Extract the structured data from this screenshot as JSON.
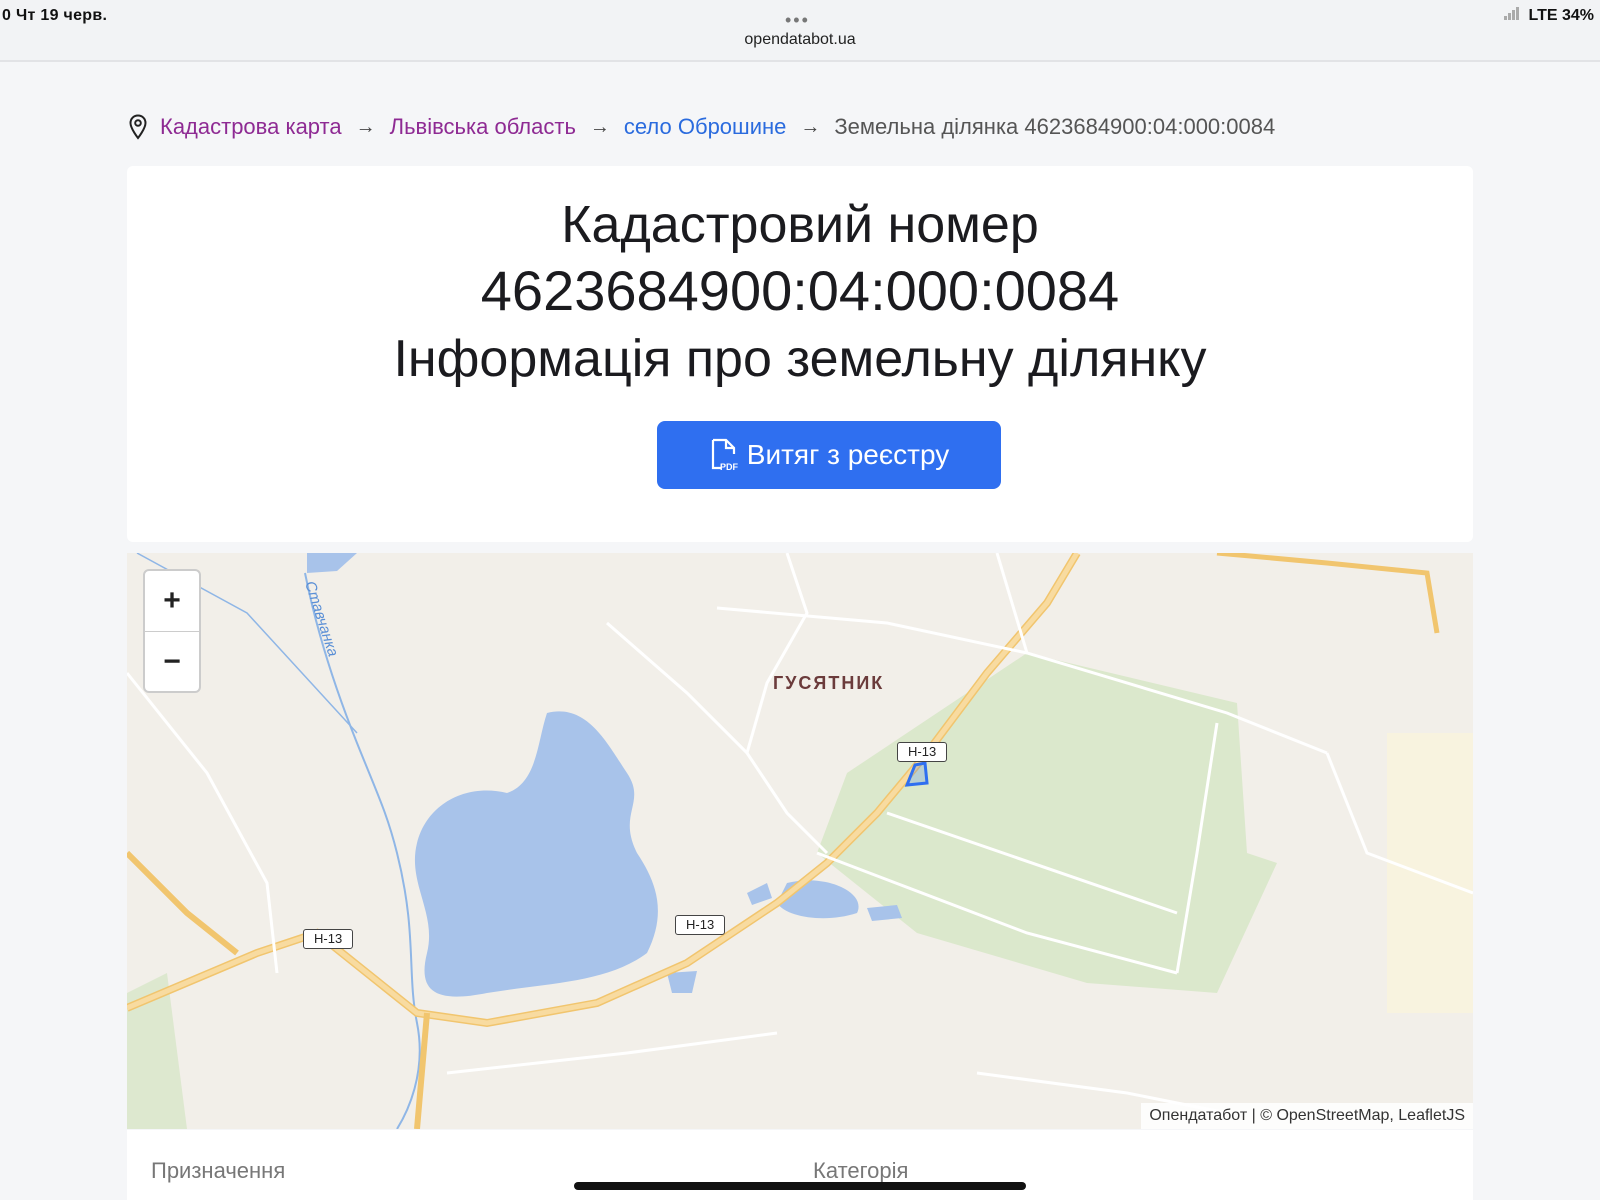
{
  "status_bar": {
    "time": "0   Чт 19 черв.",
    "url": "opendatabot.ua",
    "network": "LTE",
    "battery": "34%"
  },
  "breadcrumb": {
    "items": [
      "Кадастрова карта",
      "Львівська область",
      "село Оброшине"
    ],
    "current": "Земельна ділянка 4623684900:04:000:0084"
  },
  "header": {
    "title_line1": "Кадастровий номер",
    "title_line2": "4623684900:04:000:0084",
    "title_line3": "Інформація про земельну ділянку",
    "pdf_button_label": "Витяг з реєстру"
  },
  "map": {
    "zoom_in": "+",
    "zoom_out": "−",
    "place_label": "ГУСЯТНИК",
    "river_label": "Ставчанка",
    "road_labels": [
      "Н-13",
      "Н-13",
      "Н-13"
    ],
    "attribution": "Опендатабот | © OpenStreetMap, LeafletJS"
  },
  "details": {
    "purpose_label": "Призначення",
    "category_label": "Категорія"
  }
}
